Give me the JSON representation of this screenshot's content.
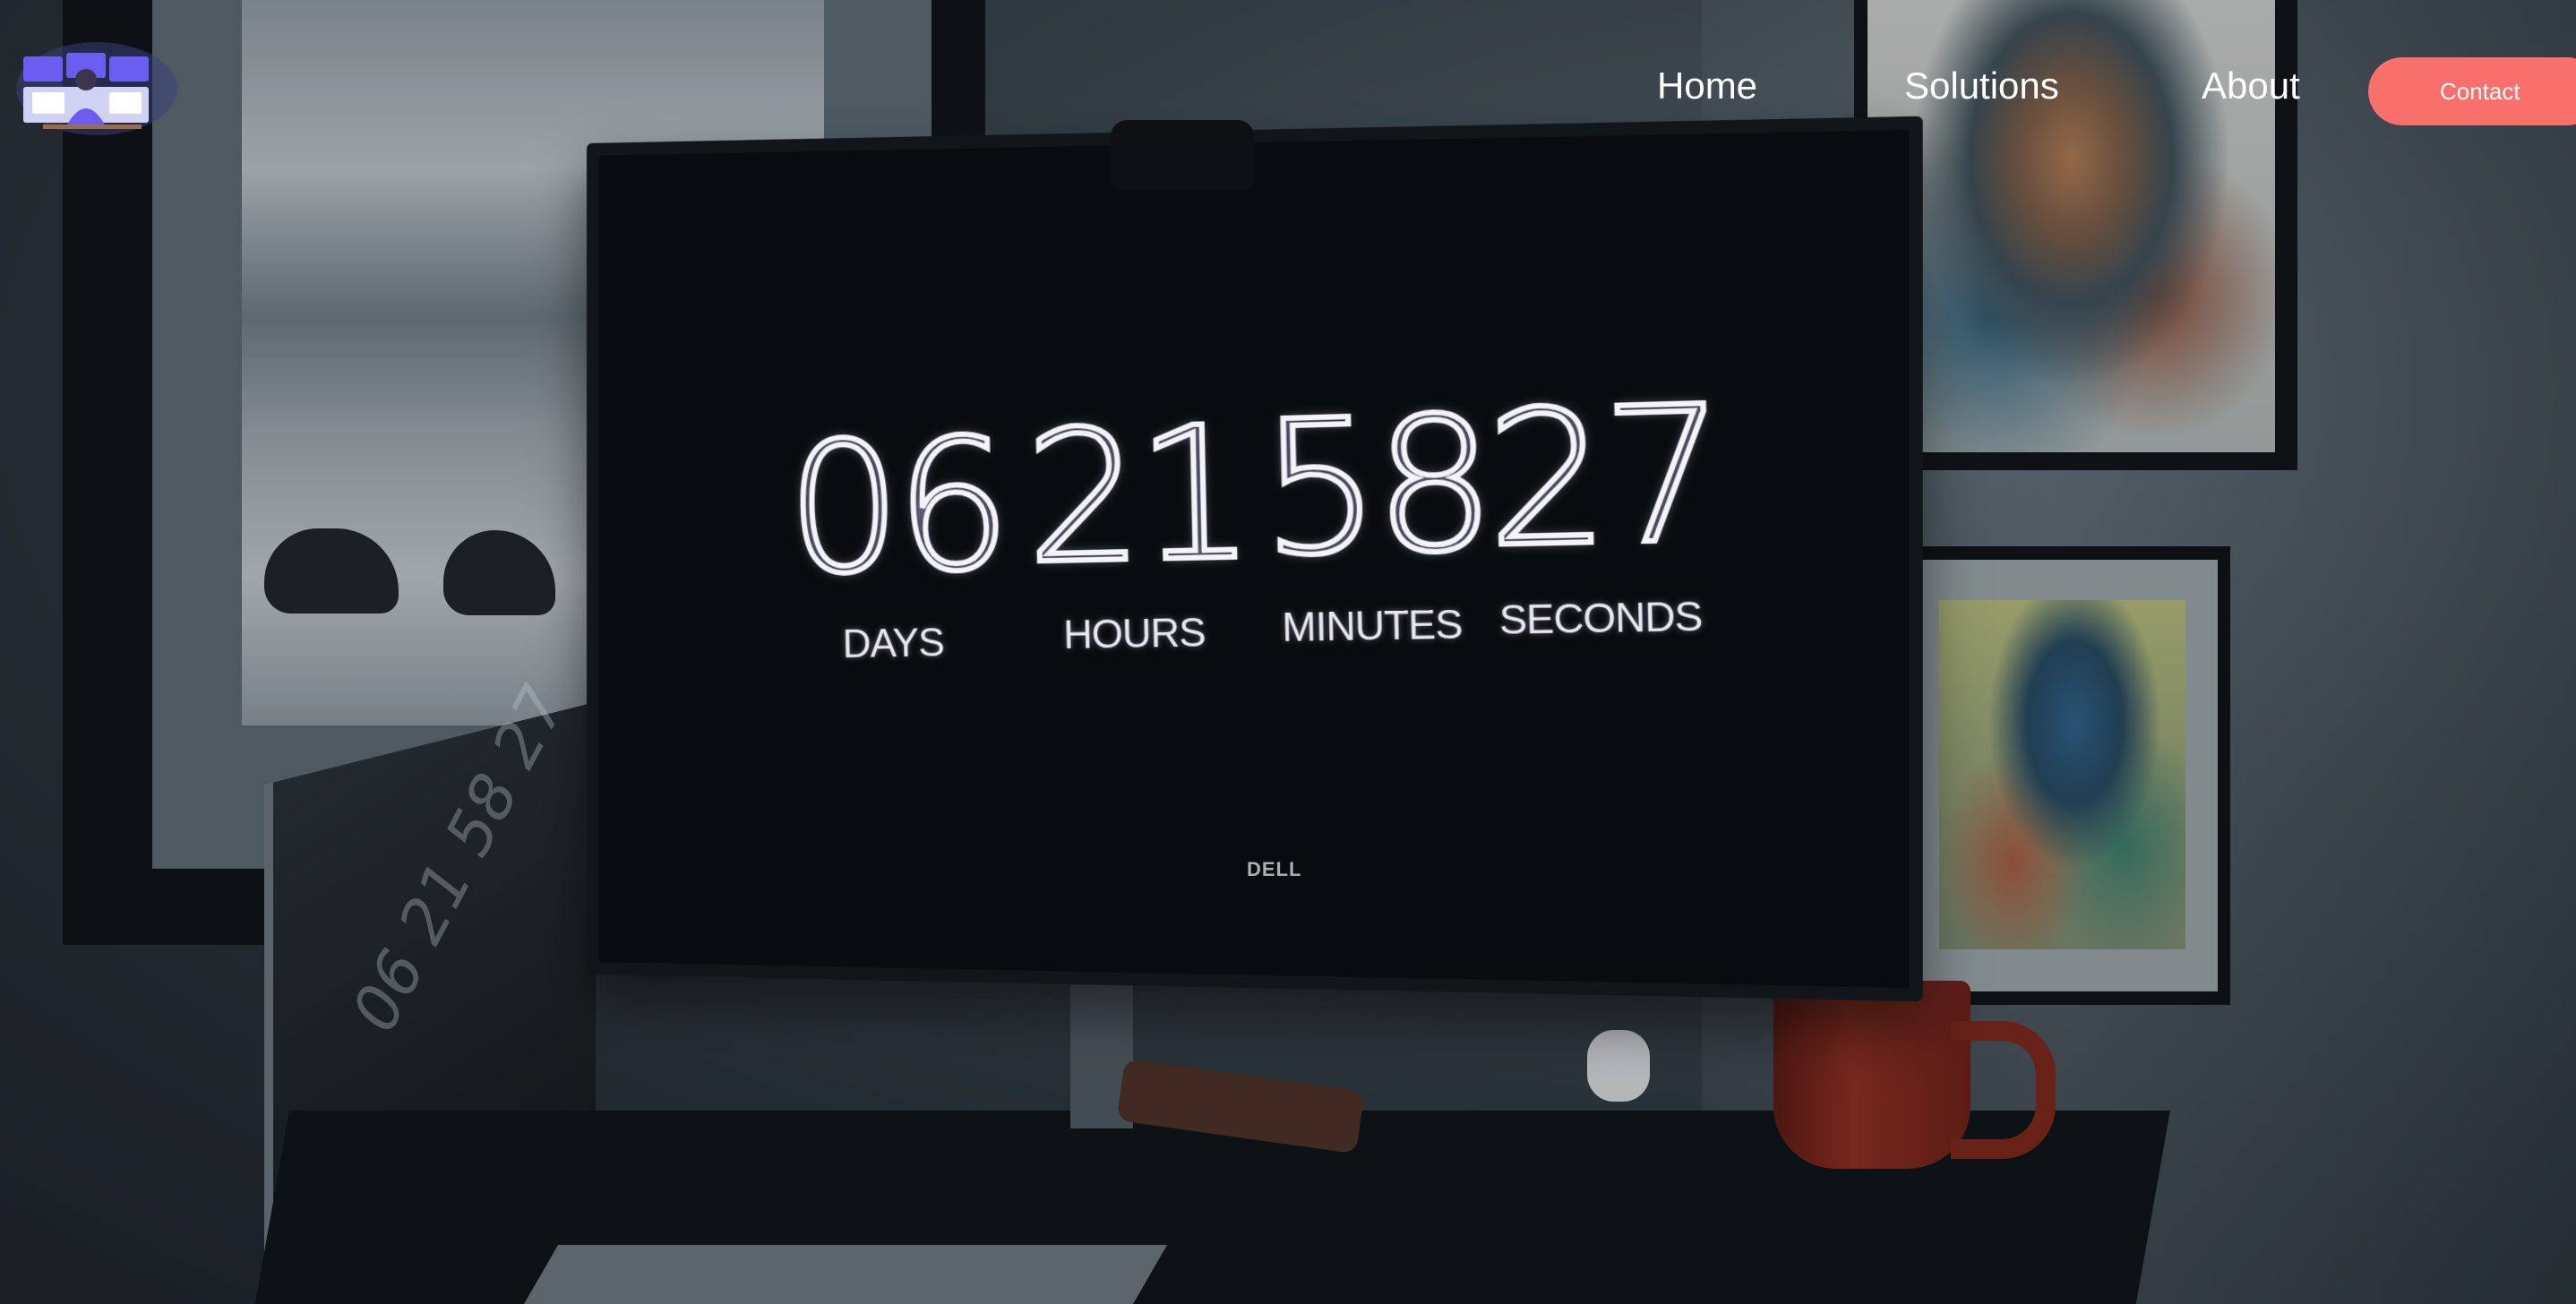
{
  "nav": {
    "logo_icon": "operator-monitors-icon",
    "links": [
      {
        "label": "Home"
      },
      {
        "label": "Solutions"
      },
      {
        "label": "About"
      }
    ],
    "contact_label": "Contact"
  },
  "countdown": {
    "days": {
      "value": "06",
      "label": "DAYS"
    },
    "hours": {
      "value": "21",
      "label": "HOURS"
    },
    "minutes": {
      "value": "58",
      "label": "MINUTES"
    },
    "seconds": {
      "value": "27",
      "label": "SECONDS"
    }
  },
  "laptop_reflection": "06 21 58 27",
  "monitor_brand": "DELL",
  "colors": {
    "contact_button": "#f96f6c",
    "logo_accent": "#6a5df0",
    "nav_text": "#ffffff"
  }
}
